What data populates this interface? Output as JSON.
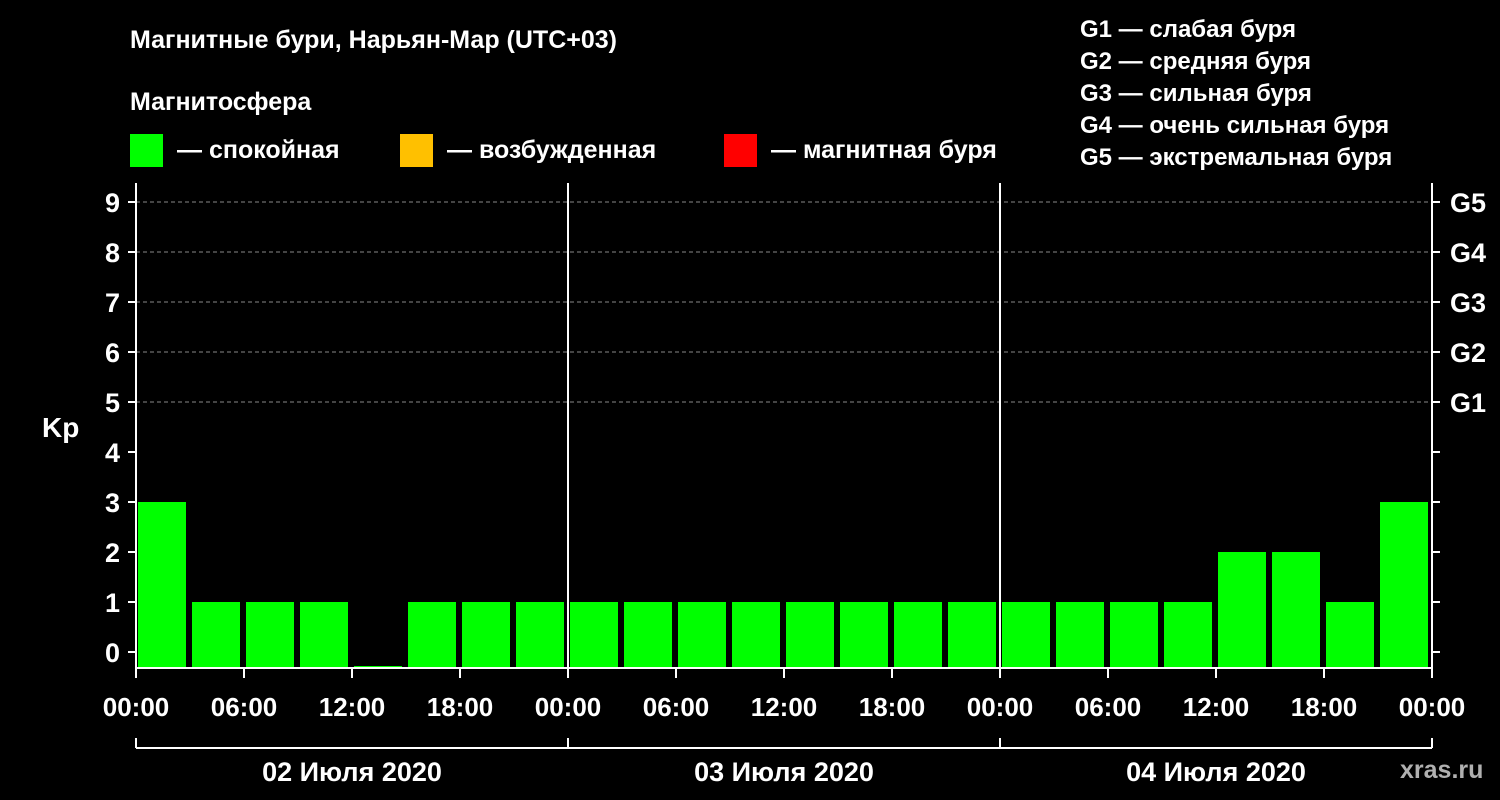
{
  "chart_data": {
    "type": "bar",
    "title": "Магнитные бури, Нарьян-Мар (UTC+03)",
    "legend_title": "Магнитосфера",
    "legend": [
      {
        "label": "— спокойная",
        "color": "#00ff00"
      },
      {
        "label": "— возбужденная",
        "color": "#ffc000"
      },
      {
        "label": "— магнитная буря",
        "color": "#ff0000"
      }
    ],
    "g_scale_legend": [
      "G1 — слабая буря",
      "G2 — средняя буря",
      "G3 — сильная буря",
      "G4 — очень сильная буря",
      "G5 — экстремальная буря"
    ],
    "ylabel": "Kp",
    "ylim": [
      0,
      9
    ],
    "y_ticks": [
      "0",
      "1",
      "2",
      "3",
      "4",
      "5",
      "6",
      "7",
      "8",
      "9"
    ],
    "right_ticks": [
      {
        "value": 5,
        "label": "G1"
      },
      {
        "value": 6,
        "label": "G2"
      },
      {
        "value": 7,
        "label": "G3"
      },
      {
        "value": 8,
        "label": "G4"
      },
      {
        "value": 9,
        "label": "G5"
      }
    ],
    "x_ticks": [
      "00:00",
      "06:00",
      "12:00",
      "18:00",
      "00:00",
      "06:00",
      "12:00",
      "18:00",
      "00:00",
      "06:00",
      "12:00",
      "18:00",
      "00:00"
    ],
    "days": [
      "02 Июля 2020",
      "03 Июля 2020",
      "04 Июля 2020"
    ],
    "interval_hours": 3,
    "values": [
      3,
      1,
      1,
      1,
      0,
      1,
      1,
      1,
      1,
      1,
      1,
      1,
      1,
      1,
      1,
      1,
      1,
      1,
      1,
      1,
      2,
      2,
      1,
      3
    ],
    "bar_color": "#00ff00",
    "grid": true,
    "watermark": "xras.ru"
  }
}
